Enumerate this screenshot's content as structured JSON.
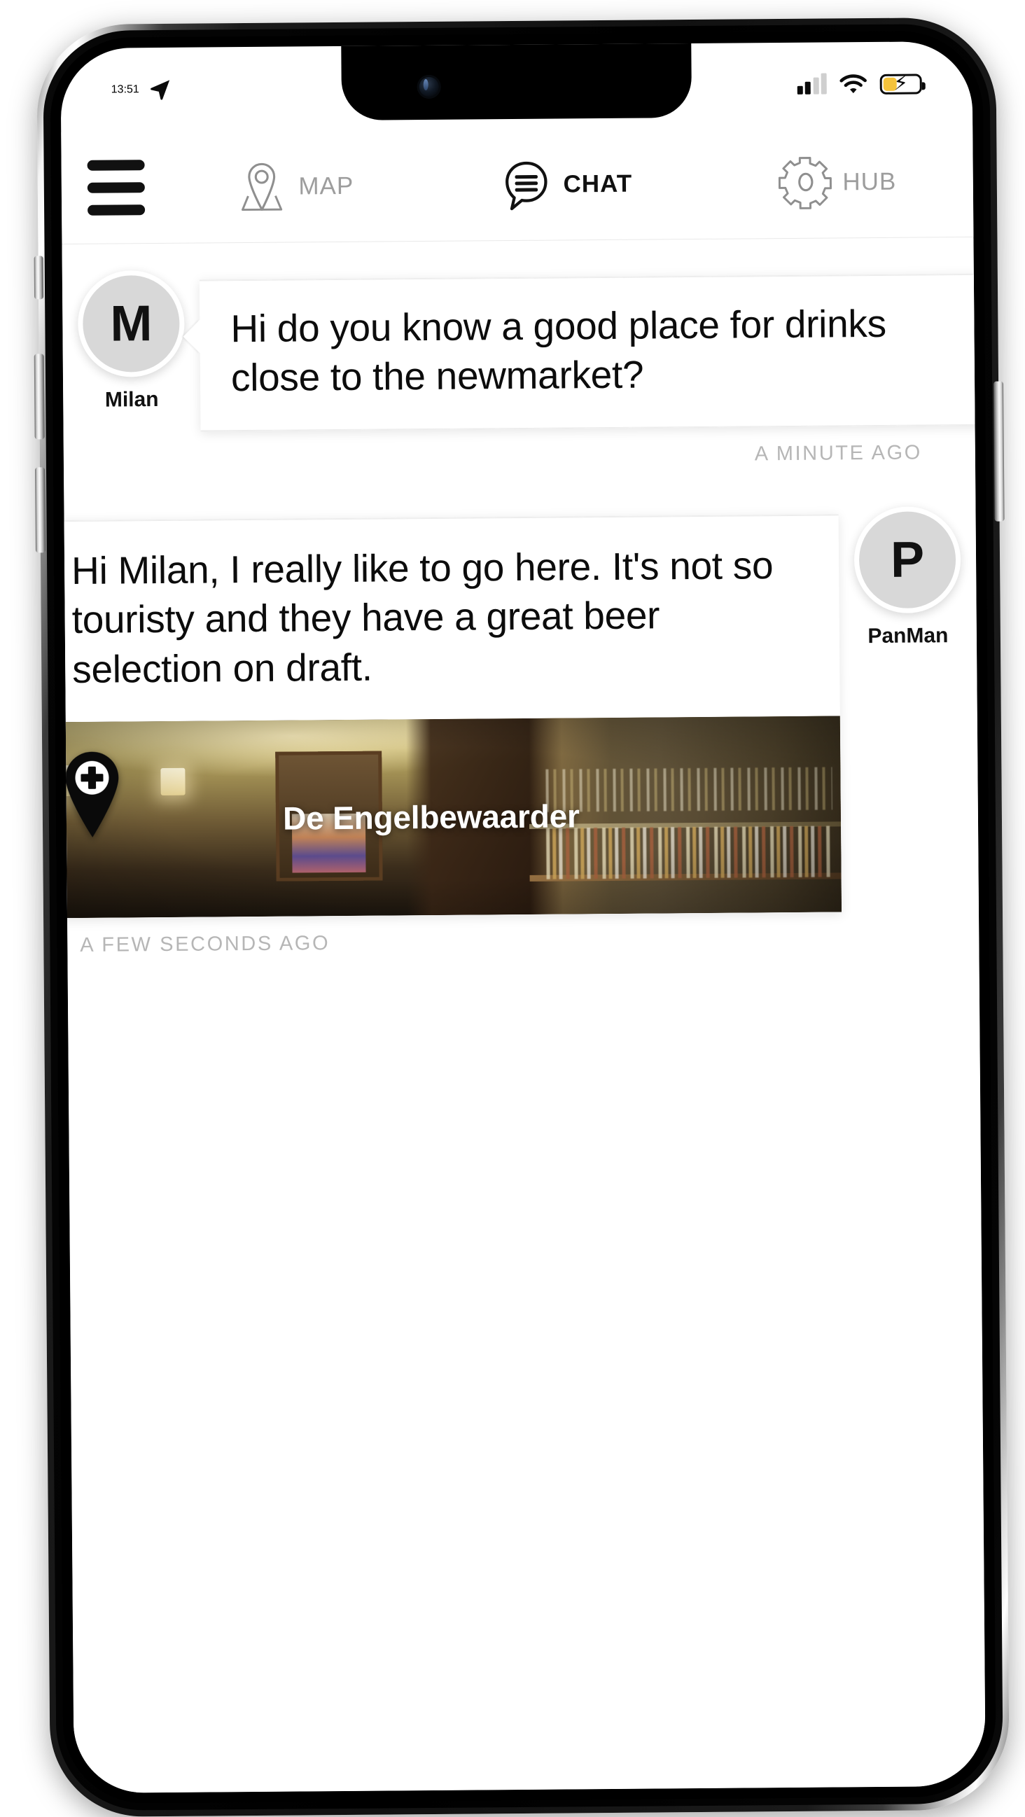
{
  "status_bar": {
    "time": "13:51",
    "location_arrow_icon": "location-arrow-icon",
    "signal_icon": "cellular-signal-icon",
    "signal_bars_total": 4,
    "signal_bars_filled": 2,
    "wifi_icon": "wifi-icon",
    "battery_icon": "battery-charging-icon",
    "battery_charging": true,
    "battery_color": "#f5c33b",
    "battery_level_percent": 35
  },
  "top_nav": {
    "menu_icon": "hamburger-menu-icon",
    "tabs": [
      {
        "id": "map",
        "label": "MAP",
        "icon": "map-pin-icon",
        "active": false
      },
      {
        "id": "chat",
        "label": "CHAT",
        "icon": "chat-bubble-icon",
        "active": true
      },
      {
        "id": "hub",
        "label": "HUB",
        "icon": "gear-icon",
        "active": false
      }
    ]
  },
  "chat": {
    "messages": [
      {
        "id": "msg-1",
        "direction": "incoming",
        "author": "Milan",
        "avatar_initial": "M",
        "text": "Hi do you know a good place for drinks close to the newmarket?",
        "timestamp": "A MINUTE AGO"
      },
      {
        "id": "msg-2",
        "direction": "outgoing",
        "author": "PanMan",
        "avatar_initial": "P",
        "text": "Hi Milan, I really like to go here. It's not so touristy and they have a great beer selection on draft.",
        "timestamp": "A FEW SECONDS AGO",
        "attachment": {
          "type": "place-card",
          "place_name": "De Engelbewaarder",
          "pin_icon": "map-pin-plus-icon",
          "photo_alt": "bar-interior-photo"
        }
      }
    ]
  },
  "colors": {
    "accent_yellow": "#f5c33b",
    "avatar_bg": "#d8d8d8",
    "text_primary": "#0c0c0c",
    "text_muted": "#9d9d9d",
    "timestamp": "#b6b6b6",
    "divider": "#e9e9e9"
  }
}
